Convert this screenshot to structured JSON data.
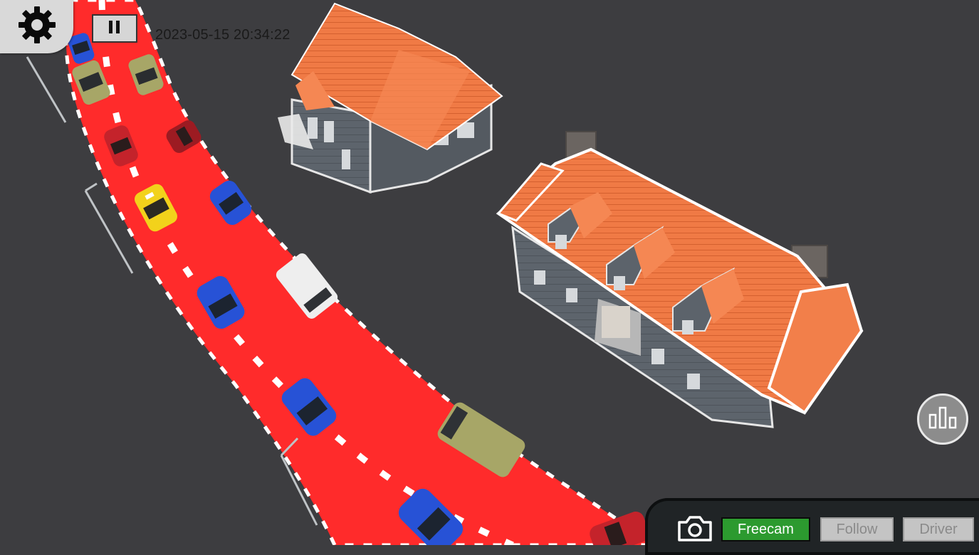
{
  "hud": {
    "timestamp": "2023-05-15 20:34:22",
    "settings_icon": "gear-icon",
    "pause_icon": "pause-icon",
    "stats_icon": "bar-chart-icon"
  },
  "camera_bar": {
    "screenshot_icon": "camera-icon",
    "modes": [
      {
        "label": "Freecam",
        "active": true
      },
      {
        "label": "Follow",
        "active": false
      },
      {
        "label": "Driver",
        "active": false
      }
    ]
  },
  "colors": {
    "road": "#ff2b2b",
    "ground": "#3d3d40",
    "active_mode": "#2c9a2f",
    "inactive_mode": "#c4c4c4",
    "roof": "#f07a45"
  }
}
